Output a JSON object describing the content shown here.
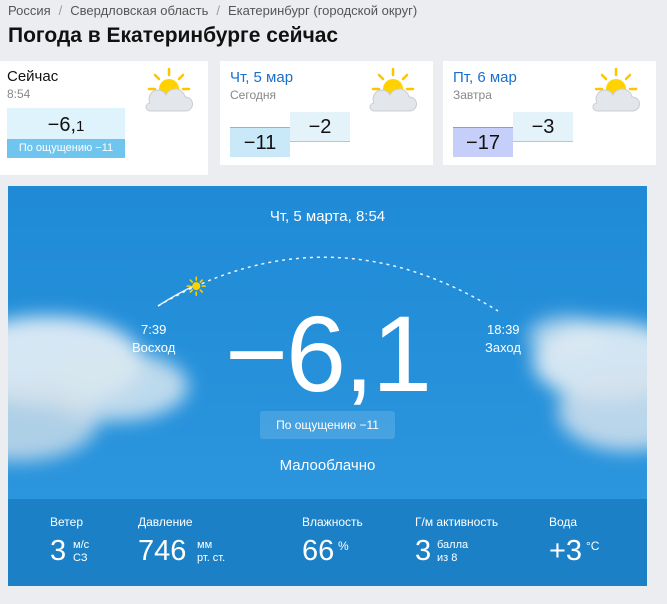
{
  "breadcrumb": {
    "items": [
      "Россия",
      "Свердловская область",
      "Екатеринбург (городской округ)"
    ],
    "separator": "/"
  },
  "page_title": "Погода в Екатеринбурге сейчас",
  "now_card": {
    "title": "Сейчас",
    "time": "8:54",
    "temp_int": "−6,",
    "temp_frac": "1",
    "feels_like": "По ощущению −11",
    "icon": "partly-cloudy-sun-icon"
  },
  "days": [
    {
      "title": "Чт, 5 мар",
      "subtitle": "Сегодня",
      "temp_min": "−11",
      "temp_max": "−2",
      "icon": "partly-cloudy-sun-icon"
    },
    {
      "title": "Пт, 6 мар",
      "subtitle": "Завтра",
      "temp_min": "−17",
      "temp_max": "−3",
      "icon": "partly-cloudy-sun-icon"
    }
  ],
  "hero": {
    "datetime": "Чт, 5 марта, 8:54",
    "sunrise_time": "7:39",
    "sunrise_label": "Восход",
    "sunset_time": "18:39",
    "sunset_label": "Заход",
    "temperature": "−6,1",
    "feels_like": "По ощущению −11",
    "condition": "Малооблачно",
    "sun_progress": 0.12,
    "colors": {
      "background": "#228ed8",
      "stats_bar": "#1c80c6",
      "sun": "#ffd200"
    }
  },
  "stats": {
    "wind": {
      "label": "Ветер",
      "value": "3",
      "unit_top": "м/с",
      "unit_bottom": "СЗ"
    },
    "pressure": {
      "label": "Давление",
      "value": "746",
      "unit_top": "мм",
      "unit_bottom": "рт. ст."
    },
    "humidity": {
      "label": "Влажность",
      "value": "66",
      "unit": "%"
    },
    "geomagnetic": {
      "label": "Г/м активность",
      "value": "3",
      "unit_top": "балла",
      "unit_bottom": "из 8"
    },
    "water": {
      "label": "Вода",
      "value": "+3",
      "unit": "°C"
    }
  }
}
